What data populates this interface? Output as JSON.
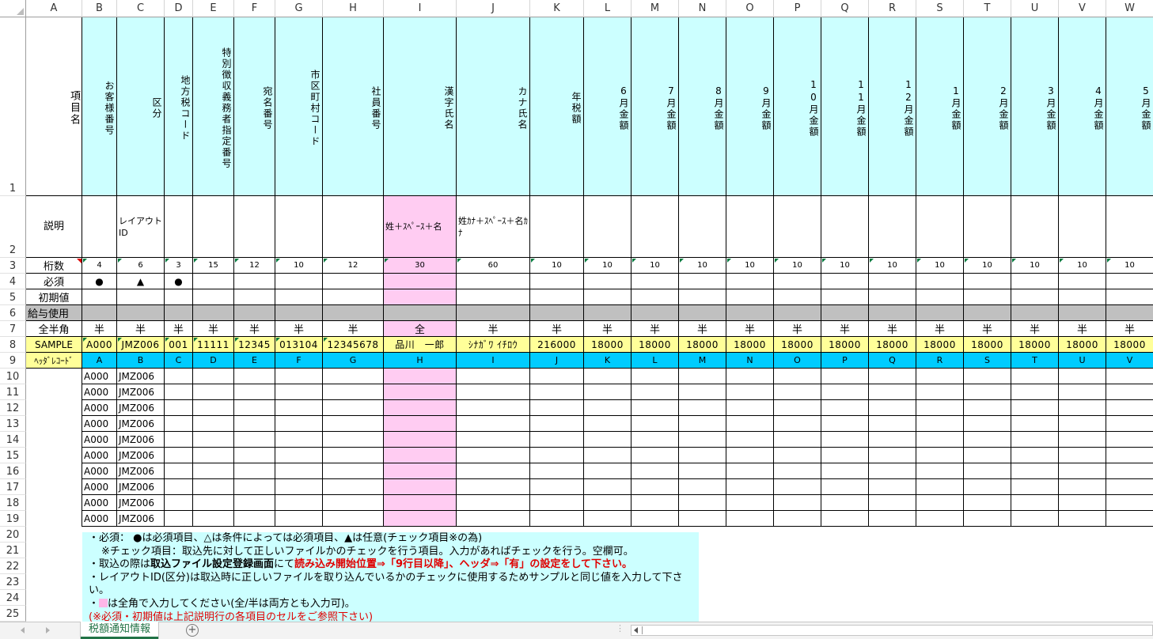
{
  "columns": [
    "A",
    "B",
    "C",
    "D",
    "E",
    "F",
    "G",
    "H",
    "I",
    "J",
    "K",
    "L",
    "M",
    "N",
    "O",
    "P",
    "Q",
    "R",
    "S",
    "T",
    "U",
    "V",
    "W"
  ],
  "rows": [
    "1",
    "2",
    "3",
    "4",
    "5",
    "6",
    "7",
    "8",
    "9",
    "10",
    "11",
    "12",
    "13",
    "14",
    "15",
    "16",
    "17",
    "18",
    "19",
    "20",
    "21",
    "22",
    "23",
    "24",
    "25"
  ],
  "headers": [
    "項目名",
    "お客様番号",
    "区分",
    "地方税コード",
    "特別徴収義務者指定番号",
    "宛名番号",
    "市区町村コード",
    "社員番号",
    "漢字氏名",
    "カナ氏名",
    "年税額",
    "6月金額",
    "7月金額",
    "8月金額",
    "9月金額",
    "10月金額",
    "11月金額",
    "12月金額",
    "1月金額",
    "2月金額",
    "3月金額",
    "4月金額",
    "5月金額"
  ],
  "descriptions": [
    "説明",
    "",
    "レイアウトID",
    "",
    "",
    "",
    "",
    "",
    "姓＋ｽﾍﾟｰｽ＋名",
    "姓ｶﾅ＋ｽﾍﾟｰｽ＋名ｶﾅ",
    "",
    "",
    "",
    "",
    "",
    "",
    "",
    "",
    "",
    "",
    "",
    "",
    ""
  ],
  "digits": [
    "桁数",
    "4",
    "6",
    "3",
    "15",
    "12",
    "10",
    "12",
    "30",
    "60",
    "10",
    "10",
    "10",
    "10",
    "10",
    "10",
    "10",
    "10",
    "10",
    "10",
    "10",
    "10",
    "10"
  ],
  "required": [
    "必須",
    "●",
    "▲",
    "●",
    "",
    "",
    "",
    "",
    "",
    "",
    "",
    "",
    "",
    "",
    "",
    "",
    "",
    "",
    "",
    "",
    "",
    "",
    ""
  ],
  "initial": [
    "初期値",
    "",
    "",
    "",
    "",
    "",
    "",
    "",
    "",
    "",
    "",
    "",
    "",
    "",
    "",
    "",
    "",
    "",
    "",
    "",
    "",
    "",
    ""
  ],
  "salary": [
    "給与使用",
    "",
    "",
    "",
    "",
    "",
    "",
    "",
    "",
    "",
    "",
    "",
    "",
    "",
    "",
    "",
    "",
    "",
    "",
    "",
    "",
    "",
    ""
  ],
  "width": [
    "全半角",
    "半",
    "半",
    "半",
    "半",
    "半",
    "半",
    "半",
    "全",
    "半",
    "半",
    "半",
    "半",
    "半",
    "半",
    "半",
    "半",
    "半",
    "半",
    "半",
    "半",
    "半",
    "半"
  ],
  "sample": [
    "SAMPLE",
    "A000",
    "JMZ006",
    "001",
    "11111",
    "12345",
    "013104",
    "12345678",
    "品川　一郎",
    "ｼﾅｶﾞﾜ ｲﾁﾛｳ",
    "216000",
    "18000",
    "18000",
    "18000",
    "18000",
    "18000",
    "18000",
    "18000",
    "18000",
    "18000",
    "18000",
    "18000",
    "18000"
  ],
  "header_record": [
    "ﾍｯﾀﾞﾚｺｰﾄﾞ",
    "A",
    "B",
    "C",
    "D",
    "E",
    "F",
    "G",
    "H",
    "I",
    "J",
    "K",
    "L",
    "M",
    "N",
    "O",
    "P",
    "Q",
    "R",
    "S",
    "T",
    "U",
    "V"
  ],
  "data_rows": [
    [
      "A000",
      "JMZ006"
    ],
    [
      "A000",
      "JMZ006"
    ],
    [
      "A000",
      "JMZ006"
    ],
    [
      "A000",
      "JMZ006"
    ],
    [
      "A000",
      "JMZ006"
    ],
    [
      "A000",
      "JMZ006"
    ],
    [
      "A000",
      "JMZ006"
    ],
    [
      "A000",
      "JMZ006"
    ],
    [
      "A000",
      "JMZ006"
    ],
    [
      "A000",
      "JMZ006"
    ]
  ],
  "notes": {
    "line1": "・必須：  ●は必須項目、△は条件によっては必須項目、▲は任意(チェック項目※の為)",
    "line2": "※チェック項目：取込先に対して正しいファイルかのチェックを行う項目。入力があればチェックを行う。空欄可。",
    "line3a": "・取込の際は",
    "line3b": "取込ファイル設定登録画面",
    "line3c": "にて",
    "line3d": "読み込み開始位置⇒「9行目以降」、ヘッダ⇒「有」の設定をして下さい。",
    "line4": "・レイアウトID(区分)は取込時に正しいファイルを取り込んでいるかのチェックに使用するためサンプルと同じ値を入力して下さ",
    "line5": "い。",
    "line6a": "・",
    "line6b": "は全角で入力してください(全/半は両方とも入力可)。",
    "line7": "(※必須・初期値は上記説明行の各項目のセルをご参照下さい)"
  },
  "sheet_tab": "税額通知情報",
  "colors": {
    "header_bg": "#ccffff",
    "pink": "#ffccf2",
    "sample_bg": "#ffff99",
    "header_record_bg": "#00ccff",
    "salary_bg": "#c0c0c0",
    "excel_green": "#217346"
  }
}
